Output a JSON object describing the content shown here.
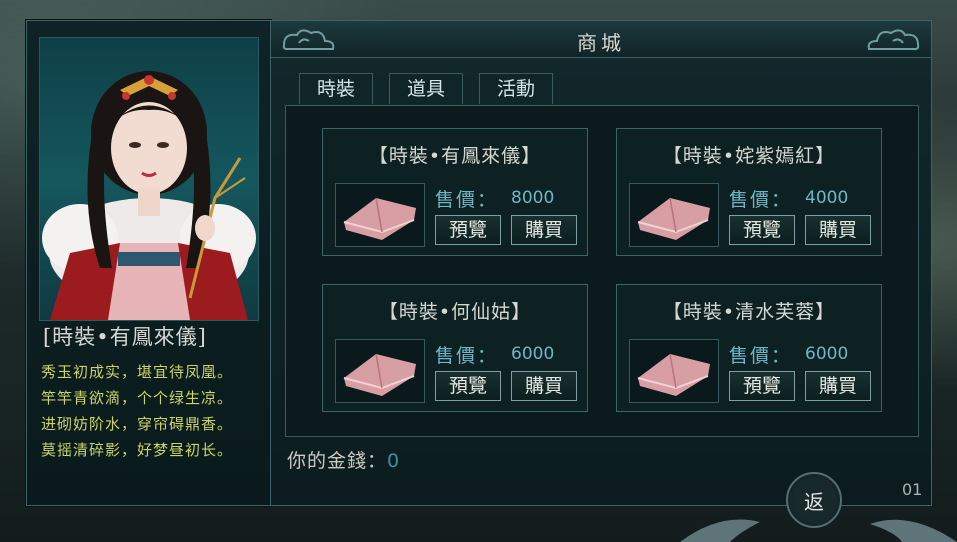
{
  "shop": {
    "title": "商城",
    "tabs": [
      {
        "label": "時裝",
        "active": true
      },
      {
        "label": "道具",
        "active": false
      },
      {
        "label": "活動",
        "active": false
      }
    ],
    "items": [
      {
        "name": "【時裝•有鳳來儀】",
        "price_label": "售價：",
        "price": "8000",
        "preview_label": "預覽",
        "buy_label": "購買"
      },
      {
        "name": "【時裝•姹紫嫣紅】",
        "price_label": "售價：",
        "price": "4000",
        "preview_label": "預覽",
        "buy_label": "購買"
      },
      {
        "name": "【時裝•何仙姑】",
        "price_label": "售價：",
        "price": "6000",
        "preview_label": "預覽",
        "buy_label": "購買"
      },
      {
        "name": "【時裝•清水芙蓉】",
        "price_label": "售價：",
        "price": "6000",
        "preview_label": "預覽",
        "buy_label": "購買"
      }
    ],
    "money_label": "你的金錢：",
    "money_value": "0",
    "back_label": "返",
    "page_number": "01"
  },
  "detail": {
    "item_name": "[時裝•有鳳來儀]",
    "poem": [
      "秀玉初成实，堪宜待凤凰。",
      "竿竿青欲滴，个个绿生凉。",
      "进砌妨阶水，穿帘碍鼎香。",
      "莫摇清碎影，好梦昼初长。"
    ]
  },
  "colors": {
    "panel_border": "#3f6267",
    "price_text": "#6fb6c6",
    "poem_text": "#c9d46a",
    "money_value": "#3c8ea0"
  },
  "icons": {
    "thumbnail": "pink-robe-icon",
    "title_ornament": "cloud-icon"
  }
}
